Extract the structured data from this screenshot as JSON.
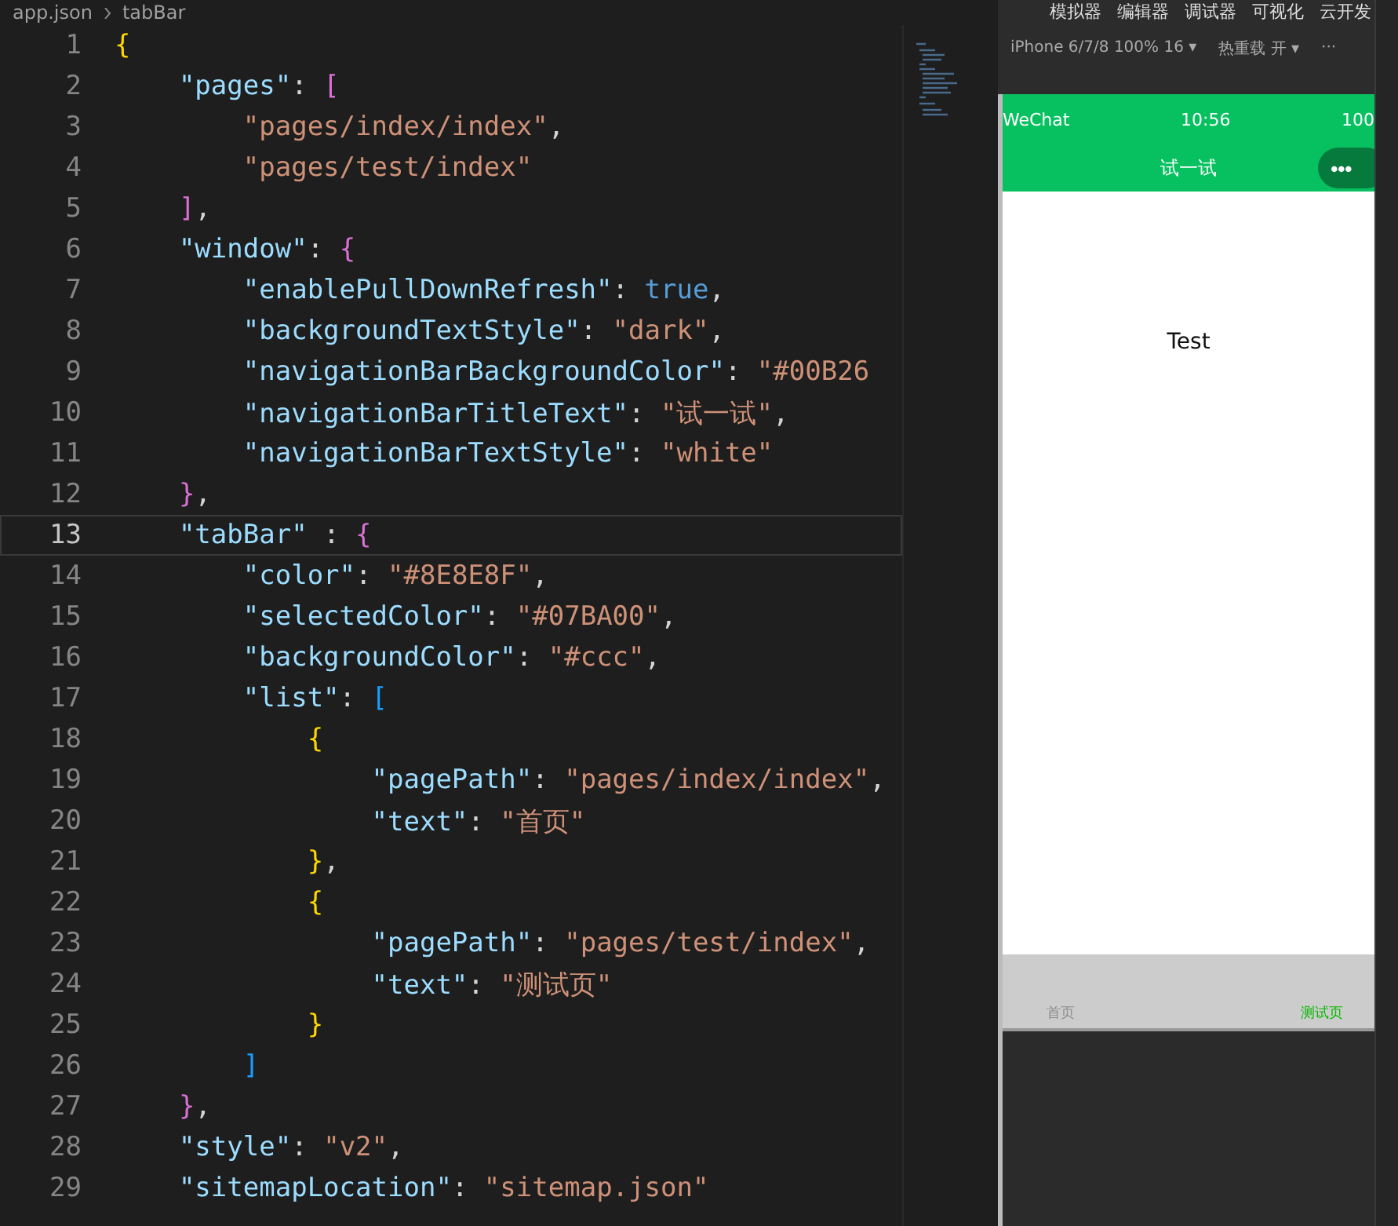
{
  "editor": {
    "breadcrumb": [
      "app.json",
      "tabBar"
    ],
    "lines": [
      {
        "number": "1",
        "current": false,
        "tokens": [
          {
            "kind": "brace",
            "text": "{"
          }
        ]
      },
      {
        "number": "2",
        "current": false,
        "tokens": [
          {
            "kind": "key",
            "text": "    \"pages\""
          },
          {
            "kind": "punct",
            "text": ": "
          },
          {
            "kind": "bracket",
            "text": "["
          }
        ]
      },
      {
        "number": "3",
        "current": false,
        "tokens": [
          {
            "kind": "string",
            "text": "        \"pages/index/index\""
          },
          {
            "kind": "punct",
            "text": ","
          }
        ]
      },
      {
        "number": "4",
        "current": false,
        "tokens": [
          {
            "kind": "string",
            "text": "        \"pages/test/index\""
          }
        ]
      },
      {
        "number": "5",
        "current": false,
        "tokens": [
          {
            "kind": "bracket",
            "text": "    ]"
          },
          {
            "kind": "punct",
            "text": ","
          }
        ]
      },
      {
        "number": "6",
        "current": false,
        "tokens": [
          {
            "kind": "key",
            "text": "    \"window\""
          },
          {
            "kind": "punct",
            "text": ": "
          },
          {
            "kind": "bracket",
            "text": "{"
          }
        ]
      },
      {
        "number": "7",
        "current": false,
        "tokens": [
          {
            "kind": "key",
            "text": "        \"enablePullDownRefresh\""
          },
          {
            "kind": "punct",
            "text": ": "
          },
          {
            "kind": "bool",
            "text": "true"
          },
          {
            "kind": "punct",
            "text": ","
          }
        ]
      },
      {
        "number": "8",
        "current": false,
        "tokens": [
          {
            "kind": "key",
            "text": "        \"backgroundTextStyle\""
          },
          {
            "kind": "punct",
            "text": ": "
          },
          {
            "kind": "string",
            "text": "\"dark\""
          },
          {
            "kind": "punct",
            "text": ","
          }
        ]
      },
      {
        "number": "9",
        "current": false,
        "tokens": [
          {
            "kind": "key",
            "text": "        \"navigationBarBackgroundColor\""
          },
          {
            "kind": "punct",
            "text": ": "
          },
          {
            "kind": "string",
            "text": "\"#00B26"
          }
        ]
      },
      {
        "number": "10",
        "current": false,
        "tokens": [
          {
            "kind": "key",
            "text": "        \"navigationBarTitleText\""
          },
          {
            "kind": "punct",
            "text": ": "
          },
          {
            "kind": "string",
            "text": "\"试一试\""
          },
          {
            "kind": "punct",
            "text": ","
          }
        ]
      },
      {
        "number": "11",
        "current": false,
        "tokens": [
          {
            "kind": "key",
            "text": "        \"navigationBarTextStyle\""
          },
          {
            "kind": "punct",
            "text": ": "
          },
          {
            "kind": "string",
            "text": "\"white\""
          }
        ]
      },
      {
        "number": "12",
        "current": false,
        "tokens": [
          {
            "kind": "bracket",
            "text": "    }"
          },
          {
            "kind": "punct",
            "text": ","
          }
        ]
      },
      {
        "number": "13",
        "current": true,
        "tokens": [
          {
            "kind": "key",
            "text": "    \"tabBar\""
          },
          {
            "kind": "punct",
            "text": " : "
          },
          {
            "kind": "bracket",
            "text": "{"
          }
        ]
      },
      {
        "number": "14",
        "current": false,
        "tokens": [
          {
            "kind": "key",
            "text": "        \"color\""
          },
          {
            "kind": "punct",
            "text": ": "
          },
          {
            "kind": "string",
            "text": "\"#8E8E8F\""
          },
          {
            "kind": "punct",
            "text": ","
          }
        ]
      },
      {
        "number": "15",
        "current": false,
        "tokens": [
          {
            "kind": "key",
            "text": "        \"selectedColor\""
          },
          {
            "kind": "punct",
            "text": ": "
          },
          {
            "kind": "string",
            "text": "\"#07BA00\""
          },
          {
            "kind": "punct",
            "text": ","
          }
        ]
      },
      {
        "number": "16",
        "current": false,
        "tokens": [
          {
            "kind": "key",
            "text": "        \"backgroundColor\""
          },
          {
            "kind": "punct",
            "text": ": "
          },
          {
            "kind": "string",
            "text": "\"#ccc\""
          },
          {
            "kind": "punct",
            "text": ","
          }
        ]
      },
      {
        "number": "17",
        "current": false,
        "tokens": [
          {
            "kind": "key",
            "text": "        \"list\""
          },
          {
            "kind": "punct",
            "text": ": "
          },
          {
            "kind": "bracket2",
            "text": "["
          }
        ]
      },
      {
        "number": "18",
        "current": false,
        "tokens": [
          {
            "kind": "brace",
            "text": "            {"
          }
        ]
      },
      {
        "number": "19",
        "current": false,
        "tokens": [
          {
            "kind": "key",
            "text": "                \"pagePath\""
          },
          {
            "kind": "punct",
            "text": ": "
          },
          {
            "kind": "string",
            "text": "\"pages/index/index\""
          },
          {
            "kind": "punct",
            "text": ","
          }
        ]
      },
      {
        "number": "20",
        "current": false,
        "tokens": [
          {
            "kind": "key",
            "text": "                \"text\""
          },
          {
            "kind": "punct",
            "text": ": "
          },
          {
            "kind": "string",
            "text": "\"首页\""
          }
        ]
      },
      {
        "number": "21",
        "current": false,
        "tokens": [
          {
            "kind": "brace",
            "text": "            }"
          },
          {
            "kind": "punct",
            "text": ","
          }
        ]
      },
      {
        "number": "22",
        "current": false,
        "tokens": [
          {
            "kind": "brace",
            "text": "            {"
          }
        ]
      },
      {
        "number": "23",
        "current": false,
        "tokens": [
          {
            "kind": "key",
            "text": "                \"pagePath\""
          },
          {
            "kind": "punct",
            "text": ": "
          },
          {
            "kind": "string",
            "text": "\"pages/test/index\""
          },
          {
            "kind": "punct",
            "text": ","
          }
        ]
      },
      {
        "number": "24",
        "current": false,
        "tokens": [
          {
            "kind": "key",
            "text": "                \"text\""
          },
          {
            "kind": "punct",
            "text": ": "
          },
          {
            "kind": "string",
            "text": "\"测试页\""
          }
        ]
      },
      {
        "number": "25",
        "current": false,
        "tokens": [
          {
            "kind": "brace",
            "text": "            }"
          }
        ]
      },
      {
        "number": "26",
        "current": false,
        "tokens": [
          {
            "kind": "bracket2",
            "text": "        ]"
          }
        ]
      },
      {
        "number": "27",
        "current": false,
        "tokens": [
          {
            "kind": "bracket",
            "text": "    }"
          },
          {
            "kind": "punct",
            "text": ","
          }
        ]
      },
      {
        "number": "28",
        "current": false,
        "tokens": [
          {
            "kind": "key",
            "text": "    \"style\""
          },
          {
            "kind": "punct",
            "text": ": "
          },
          {
            "kind": "string",
            "text": "\"v2\""
          },
          {
            "kind": "punct",
            "text": ","
          }
        ]
      },
      {
        "number": "29",
        "current": false,
        "tokens": [
          {
            "kind": "key",
            "text": "    \"sitemapLocation\""
          },
          {
            "kind": "punct",
            "text": ": "
          },
          {
            "kind": "string",
            "text": "\"sitemap.json\""
          }
        ]
      }
    ]
  },
  "simulator": {
    "menu": [
      "模拟器",
      "编辑器",
      "调试器",
      "可视化",
      "云开发"
    ],
    "device": "iPhone 6/7/8 100% 16 ▾",
    "hot_reload": "热重载 开 ▾",
    "more": "···",
    "status_bar": {
      "carrier": "WeChat",
      "time": "10:56",
      "battery": "100"
    },
    "nav_title": "试一试",
    "capsule": "•••",
    "body_text": "Test",
    "tabs": [
      {
        "label": "首页",
        "selected": false
      },
      {
        "label": "测试页",
        "selected": true
      }
    ]
  }
}
